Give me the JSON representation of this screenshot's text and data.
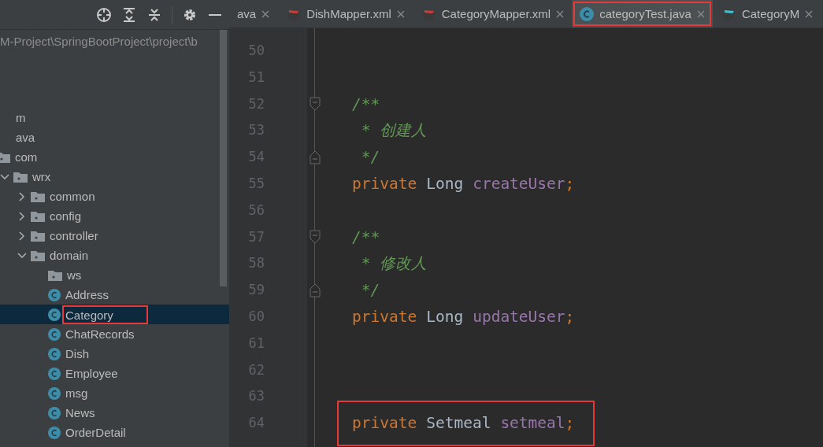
{
  "project_panel": {
    "toolbar": [
      {
        "kind": "locate"
      },
      {
        "kind": "expand"
      },
      {
        "kind": "collapse"
      },
      {
        "kind": "separator"
      },
      {
        "kind": "settings"
      },
      {
        "kind": "hide"
      }
    ],
    "path": "M-Project\\SpringBootProject\\project\\b",
    "tree": [
      {
        "label": "m",
        "kind": "text"
      },
      {
        "label": "ava",
        "kind": "text"
      },
      {
        "label": "com",
        "kind": "folder",
        "children": [
          {
            "label": "wrx",
            "kind": "folder",
            "expanded": true,
            "children": [
              {
                "label": "common",
                "kind": "folder",
                "expanded": false
              },
              {
                "label": "config",
                "kind": "folder",
                "expanded": false
              },
              {
                "label": "controller",
                "kind": "folder",
                "expanded": false
              },
              {
                "label": "domain",
                "kind": "folder",
                "expanded": true,
                "children": [
                  {
                    "label": "ws",
                    "kind": "folder",
                    "selected": false
                  },
                  {
                    "label": "Address",
                    "kind": "class",
                    "selected": false
                  },
                  {
                    "label": "Category",
                    "kind": "class",
                    "selected": true,
                    "highlighted": true
                  },
                  {
                    "label": "ChatRecords",
                    "kind": "class",
                    "selected": false
                  },
                  {
                    "label": "Dish",
                    "kind": "class",
                    "selected": false
                  },
                  {
                    "label": "Employee",
                    "kind": "class",
                    "selected": false
                  },
                  {
                    "label": "msg",
                    "kind": "class",
                    "selected": false
                  },
                  {
                    "label": "News",
                    "kind": "class",
                    "selected": false
                  },
                  {
                    "label": "OrderDetail",
                    "kind": "class",
                    "selected": false
                  }
                ]
              }
            ]
          }
        ]
      }
    ]
  },
  "tabs": [
    {
      "label": "ava",
      "kind": "java",
      "selected": false
    },
    {
      "label": "DishMapper.xml",
      "kind": "mapper",
      "selected": false
    },
    {
      "label": "CategoryMapper.xml",
      "kind": "mapper",
      "selected": false
    },
    {
      "label": "categoryTest.java",
      "kind": "class",
      "selected": true,
      "highlighted": true
    },
    {
      "label": "CategoryM",
      "kind": "mapper-alt",
      "selected": false
    }
  ],
  "editor": {
    "lines": [
      {
        "number": "50"
      },
      {
        "number": "51"
      },
      {
        "number": "52",
        "fold_start": true,
        "tokens": [
          {
            "kind": "comment",
            "text": "/**"
          }
        ]
      },
      {
        "number": "53",
        "tokens": [
          {
            "kind": "comment",
            "text": " * 创建人"
          }
        ]
      },
      {
        "number": "54",
        "fold_end": true,
        "tokens": [
          {
            "kind": "comment",
            "text": " */"
          }
        ]
      },
      {
        "number": "55",
        "tokens": [
          {
            "kind": "keyword",
            "text": "private"
          },
          {
            "kind": "type",
            "text": "Long"
          },
          {
            "kind": "field",
            "text": "createUser"
          },
          {
            "kind": "keyword",
            "text": ";"
          }
        ]
      },
      {
        "number": "56"
      },
      {
        "number": "57",
        "fold_start": true,
        "tokens": [
          {
            "kind": "comment",
            "text": "/**"
          }
        ]
      },
      {
        "number": "58",
        "tokens": [
          {
            "kind": "comment",
            "text": " * 修改人"
          }
        ]
      },
      {
        "number": "59",
        "fold_end": true,
        "tokens": [
          {
            "kind": "comment",
            "text": " */"
          }
        ]
      },
      {
        "number": "60",
        "tokens": [
          {
            "kind": "keyword",
            "text": "private"
          },
          {
            "kind": "type",
            "text": "Long"
          },
          {
            "kind": "field",
            "text": "updateUser"
          },
          {
            "kind": "keyword",
            "text": ";"
          }
        ]
      },
      {
        "number": "61"
      },
      {
        "number": "62"
      },
      {
        "number": "63"
      },
      {
        "number": "64",
        "highlighted": true,
        "tokens": [
          {
            "kind": "keyword",
            "text": "private"
          },
          {
            "kind": "type",
            "text": "Setmeal"
          },
          {
            "kind": "field",
            "text": "setmeal"
          },
          {
            "kind": "keyword",
            "text": ";"
          }
        ]
      }
    ]
  }
}
